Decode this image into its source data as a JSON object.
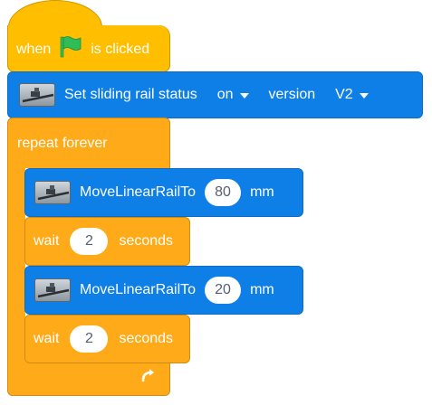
{
  "hat": {
    "when": "when",
    "flag_icon": "green-flag-icon",
    "is_clicked": "is clicked"
  },
  "set_block": {
    "label": "Set sliding rail status",
    "status_value": "on",
    "version_label": "version",
    "version_value": "V2",
    "icon": "sliding-rail-icon"
  },
  "repeat": {
    "label": "repeat forever",
    "loop_icon": "loop-arrow-icon"
  },
  "move1": {
    "label": "MoveLinearRailTo",
    "value": "80",
    "unit": "mm"
  },
  "wait1": {
    "label": "wait",
    "value": "2",
    "unit": "seconds"
  },
  "move2": {
    "label": "MoveLinearRailTo",
    "value": "20",
    "unit": "mm"
  },
  "wait2": {
    "label": "wait",
    "value": "2",
    "unit": "seconds"
  },
  "colors": {
    "events": "#FFBF00",
    "control": "#FFAB19",
    "extension": "#0F7FE8",
    "flag": "#2EBD57"
  }
}
